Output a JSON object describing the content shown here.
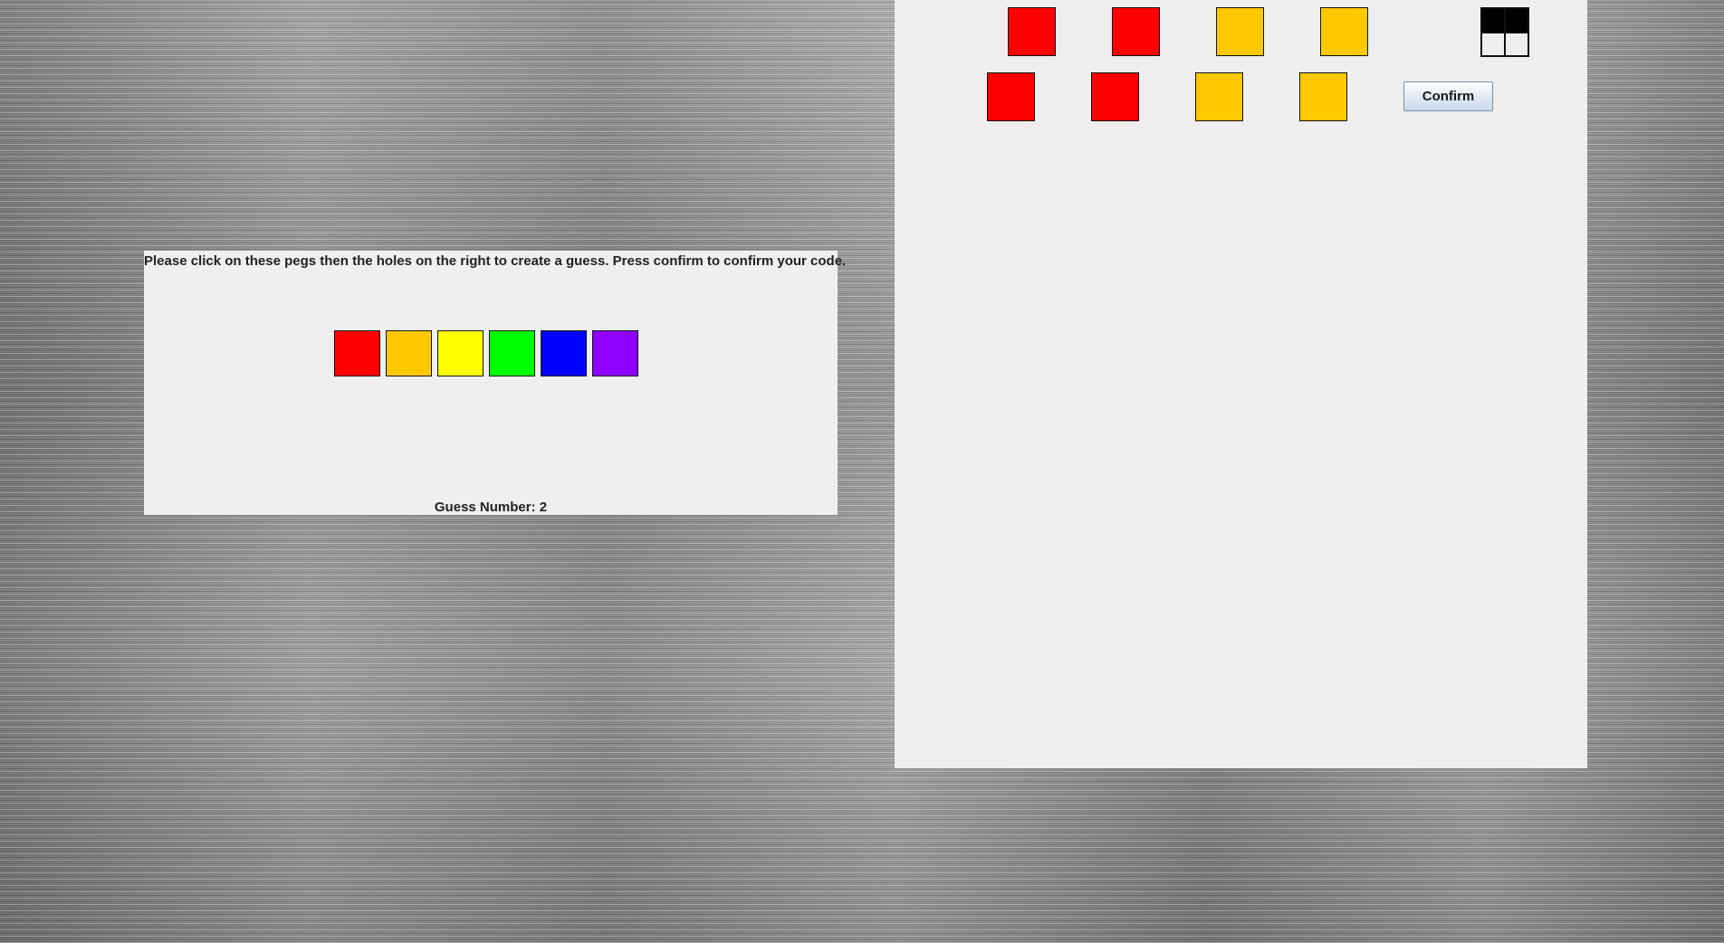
{
  "palette": {
    "instructions": "Please click on these pegs then the holes on the right to create a guess. Press confirm to confirm your code.",
    "guess_number_label": "Guess Number: 2",
    "pegs": [
      {
        "color_name": "red",
        "color": "#ff0000"
      },
      {
        "color_name": "orange",
        "color": "#ffc800"
      },
      {
        "color_name": "yellow",
        "color": "#ffff00"
      },
      {
        "color_name": "green",
        "color": "#00ff00"
      },
      {
        "color_name": "blue",
        "color": "#0000ff"
      },
      {
        "color_name": "purple",
        "color": "#8f00ff"
      }
    ]
  },
  "board": {
    "previous_guess": {
      "pegs": [
        {
          "color_name": "red",
          "color": "#ff0000"
        },
        {
          "color_name": "red",
          "color": "#ff0000"
        },
        {
          "color_name": "orange",
          "color": "#ffc800"
        },
        {
          "color_name": "orange",
          "color": "#ffc800"
        }
      ],
      "feedback": [
        "black",
        "black",
        "empty",
        "empty"
      ]
    },
    "current_guess": {
      "pegs": [
        {
          "color_name": "red",
          "color": "#ff0000"
        },
        {
          "color_name": "red",
          "color": "#ff0000"
        },
        {
          "color_name": "orange",
          "color": "#ffc800"
        },
        {
          "color_name": "orange",
          "color": "#ffc800"
        }
      ]
    },
    "confirm_label": "Confirm"
  },
  "colors": {
    "feedback_black": "#000000",
    "feedback_empty": "#eeeeee"
  }
}
